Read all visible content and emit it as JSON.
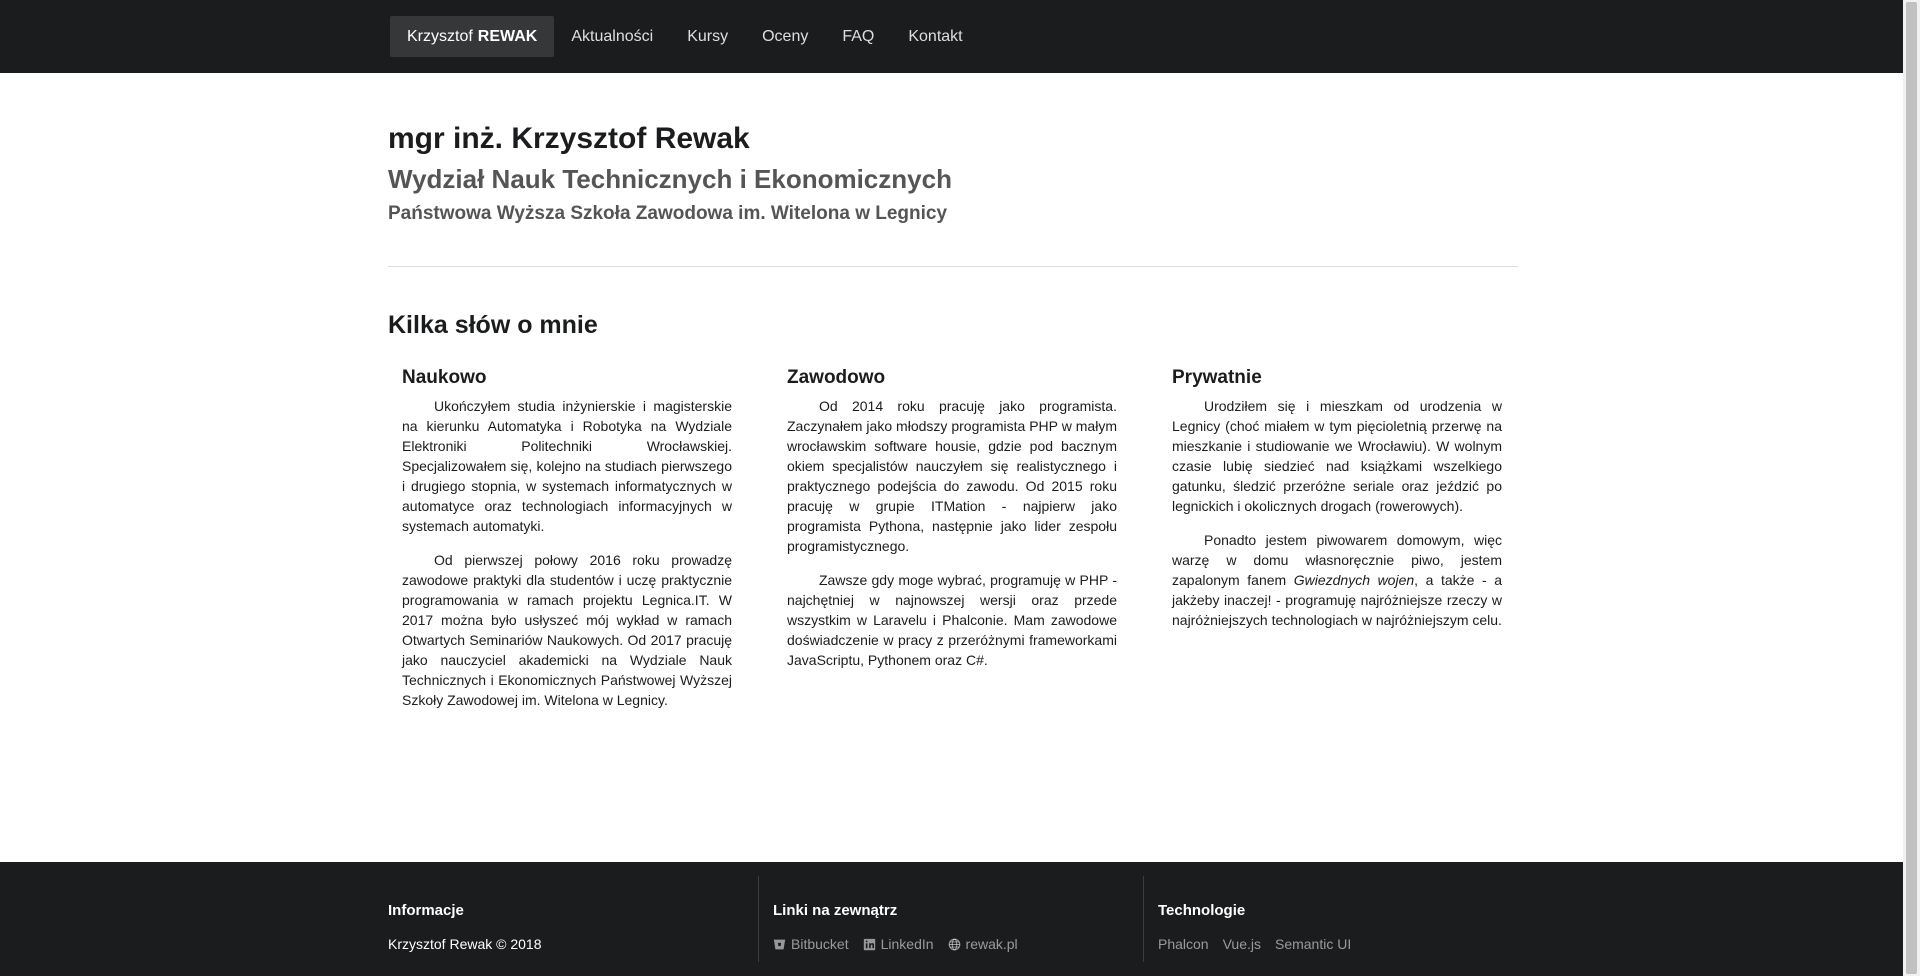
{
  "nav": {
    "brand_first": "Krzysztof",
    "brand_last": "REWAK",
    "items": [
      {
        "label": "Aktualności"
      },
      {
        "label": "Kursy"
      },
      {
        "label": "Oceny"
      },
      {
        "label": "FAQ"
      },
      {
        "label": "Kontakt"
      }
    ]
  },
  "header": {
    "name": "mgr inż. Krzysztof Rewak",
    "department": "Wydział Nauk Technicznych i Ekonomicznych",
    "school": "Państwowa Wyższa Szkoła Zawodowa im. Witelona w Legnicy"
  },
  "about": {
    "title": "Kilka słów o mnie",
    "columns": [
      {
        "heading": "Naukowo",
        "paragraphs": [
          "Ukończyłem studia inżynierskie i magisterskie na kierunku Automatyka i Robotyka na Wydziale Elektroniki Politechniki Wrocławskiej. Specjalizowałem się, kolejno na studiach pierwszego i drugiego stopnia, w systemach informatycznych w automatyce oraz technologiach informacyjnych w systemach automatyki.",
          "Od pierwszej połowy 2016 roku prowadzę zawodowe praktyki dla studentów i uczę praktycznie programowania w ramach projektu Legnica.IT. W 2017 można było usłyszeć mój wykład w ramach Otwartych Seminariów Naukowych. Od 2017 pracuję jako nauczyciel akademicki na Wydziale Nauk Technicznych i Ekonomicznych Państwowej Wyższej Szkoły Zawodowej im. Witelona w Legnicy."
        ]
      },
      {
        "heading": "Zawodowo",
        "paragraphs": [
          "Od 2014 roku pracuję jako programista. Zaczynałem jako młodszy programista PHP w małym wrocławskim software housie, gdzie pod bacznym okiem specjalistów nauczyłem się realistycznego i praktycznego podejścia do zawodu. Od 2015 roku pracuję w grupie ITMation - najpierw jako programista Pythona, następnie jako lider zespołu programistycznego.",
          "Zawsze gdy moge wybrać, programuję w PHP - najchętniej w najnowszej wersji oraz przede wszystkim w Laravelu i Phalconie. Mam zawodowe doświadczenie w pracy z przeróżnymi frameworkami JavaScriptu, Pythonem oraz C#."
        ]
      },
      {
        "heading": "Prywatnie",
        "paragraphs": [
          "Urodziłem się i mieszkam od urodzenia w Legnicy (choć miałem w tym pięcioletnią przerwę na mieszkanie i studiowanie we Wrocławiu). W wolnym czasie lubię siedzieć nad książkami wszelkiego gatunku, śledzić przeróżne seriale oraz jeździć po legnickich i okolicznych drogach (rowerowych).",
          "Ponadto jestem piwowarem domowym, więc warzę w domu własnoręcznie piwo, jestem zapalonym fanem",
          "Gwiezdnych wojen",
          ", a także - a jakżeby inaczej! - programuję najróżniejsze rzeczy w najróżniejszych technologiach w najróżniejszym celu."
        ]
      }
    ]
  },
  "footer": {
    "info": {
      "heading": "Informacje",
      "text": "Krzysztof Rewak © 2018"
    },
    "links": {
      "heading": "Linki na zewnątrz",
      "items": [
        {
          "label": "Bitbucket",
          "icon": "bitbucket-icon"
        },
        {
          "label": "LinkedIn",
          "icon": "linkedin-icon"
        },
        {
          "label": "rewak.pl",
          "icon": "globe-icon"
        }
      ]
    },
    "tech": {
      "heading": "Technologie",
      "items": [
        {
          "label": "Phalcon"
        },
        {
          "label": "Vue.js"
        },
        {
          "label": "Semantic UI"
        }
      ]
    }
  }
}
